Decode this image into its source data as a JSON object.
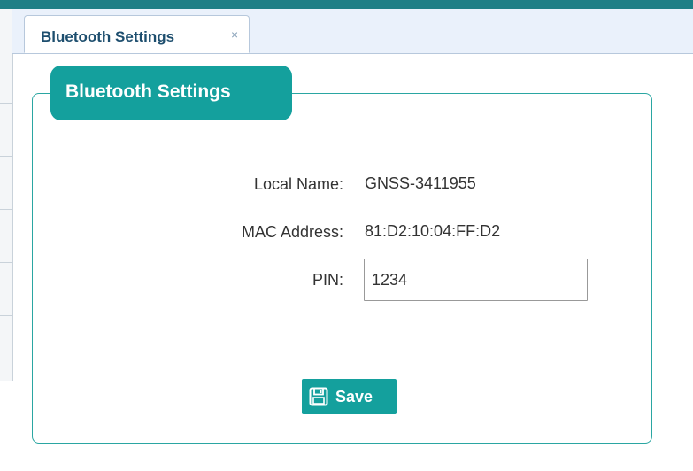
{
  "tabs": [
    {
      "label": "Bluetooth Settings",
      "close_glyph": "×",
      "icon": "close-icon"
    }
  ],
  "panel": {
    "legend": "Bluetooth Settings",
    "fields": {
      "local_name": {
        "label": "Local Name:",
        "value": "GNSS-3411955"
      },
      "mac_address": {
        "label": "MAC Address:",
        "value": "81:D2:10:04:FF:D2"
      },
      "pin": {
        "label": "PIN:",
        "value": "1234"
      }
    },
    "save_button": {
      "label": "Save",
      "icon": "floppy-disk-icon"
    }
  },
  "colors": {
    "accent": "#14a09d",
    "top_stripe": "#1f7f86",
    "tab_text": "#1d4e6e",
    "tabbar_bg": "#eaf1fb"
  }
}
